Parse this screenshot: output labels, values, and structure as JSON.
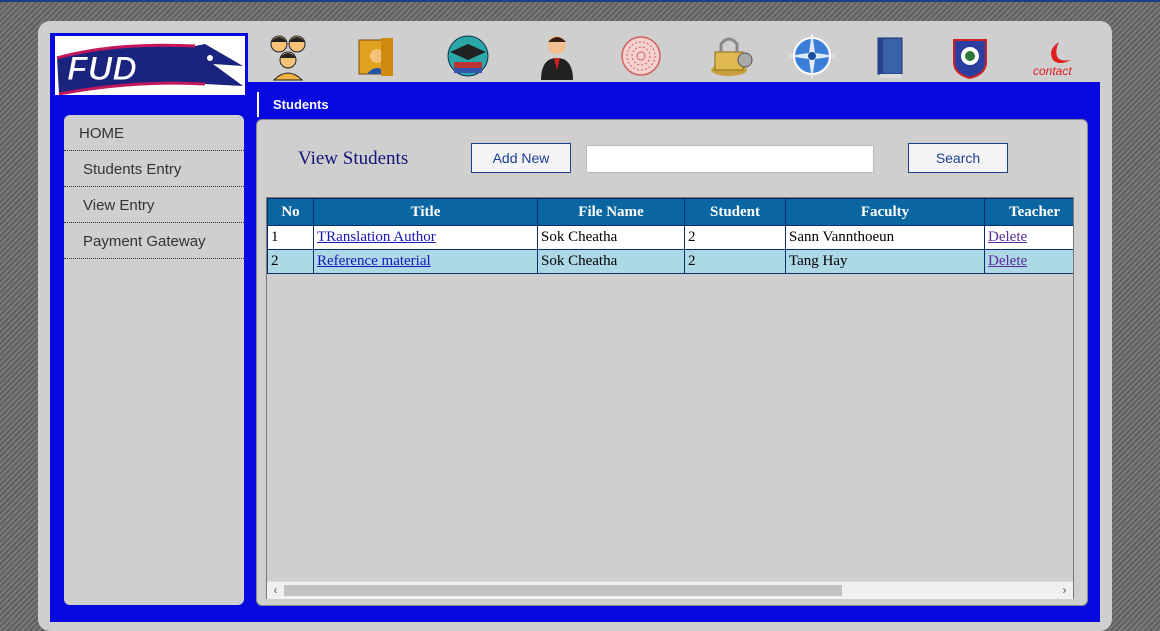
{
  "logo": {
    "text": "FUD"
  },
  "nav_icons": [
    {
      "name": "students-group-icon"
    },
    {
      "name": "teacher-book-icon"
    },
    {
      "name": "graduation-cap-icon"
    },
    {
      "name": "user-suit-icon"
    },
    {
      "name": "globe-sphere-icon"
    },
    {
      "name": "lock-coins-icon"
    },
    {
      "name": "compass-icon"
    },
    {
      "name": "book-icon"
    },
    {
      "name": "badge-emblem-icon"
    },
    {
      "name": "contact-icon",
      "label": "contact"
    }
  ],
  "subbar": {
    "tab_label": "Students"
  },
  "sidebar": {
    "items": [
      {
        "label": "HOME"
      },
      {
        "label": "Students Entry"
      },
      {
        "label": "View Entry"
      },
      {
        "label": "Payment Gateway"
      }
    ]
  },
  "main": {
    "title": "View Students",
    "add_button": "Add New",
    "search_button": "Search",
    "search_value": ""
  },
  "table": {
    "headers": [
      "No",
      "Title",
      "File Name",
      "Student",
      "Faculty",
      "Teacher"
    ],
    "rows": [
      {
        "no": "1",
        "title": "TRanslation Author",
        "file_name": "Sok Cheatha",
        "student": "2",
        "faculty": "Sann Vannthoeun",
        "action": "Delete"
      },
      {
        "no": "2",
        "title": "Reference material",
        "file_name": "Sok Cheatha",
        "student": "2",
        "faculty": "Tang Hay",
        "action": "Delete"
      }
    ]
  },
  "colors": {
    "header_blue": "#0808e0",
    "grid_header": "#0a66a0",
    "alt_row": "#add8e6"
  }
}
